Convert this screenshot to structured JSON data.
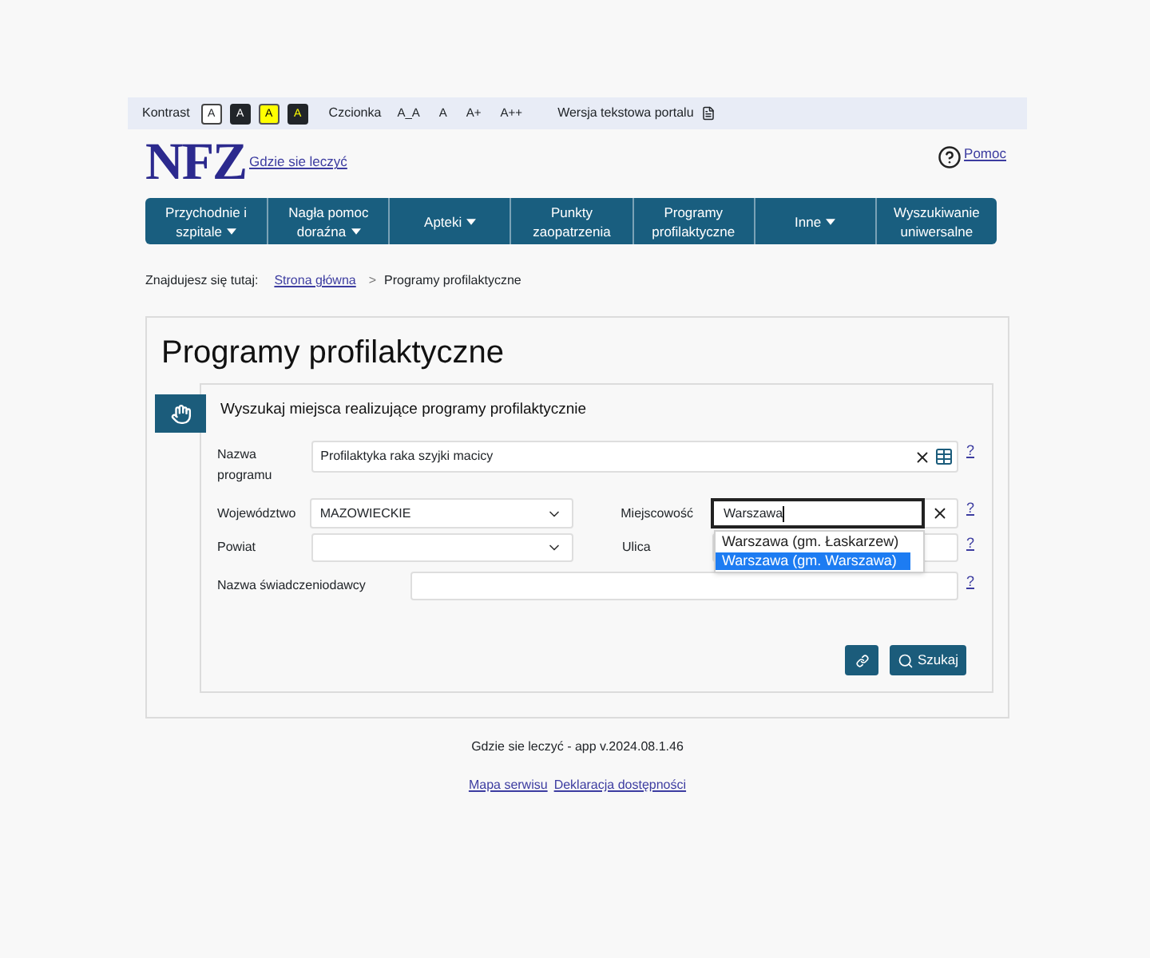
{
  "accessibility_bar": {
    "contrast_label": "Kontrast",
    "contrast_options": [
      {
        "label": "A",
        "kind": "standard"
      },
      {
        "label": "A",
        "kind": "inverse"
      },
      {
        "label": "A",
        "kind": "yellow"
      },
      {
        "label": "A",
        "kind": "blackyellow"
      }
    ],
    "font_label": "Czcionka",
    "font_options": [
      "A_A",
      "A",
      "A+",
      "A++"
    ],
    "text_version": "Wersja tekstowa portalu"
  },
  "header": {
    "logo": "NFZ",
    "site_link": "Gdzie sie leczyć",
    "help_link": "Pomoc"
  },
  "nav": [
    {
      "label": "Przychodnie i szpitale",
      "dropdown": true
    },
    {
      "label": "Nagła pomoc doraźna",
      "dropdown": true
    },
    {
      "label": "Apteki",
      "dropdown": true
    },
    {
      "label": "Punkty zaopatrzenia",
      "dropdown": false
    },
    {
      "label": "Programy profilaktyczne",
      "dropdown": false
    },
    {
      "label": "Inne",
      "dropdown": true
    },
    {
      "label": "Wyszukiwanie uniwersalne",
      "dropdown": false
    }
  ],
  "breadcrumb": {
    "label": "Znajdujesz się tutaj:",
    "separator": ">",
    "items": [
      {
        "label": "Strona główna",
        "kind": "link"
      },
      {
        "label": "Programy profilaktyczne",
        "kind": "current"
      }
    ]
  },
  "page_title": "Programy profilaktyczne",
  "search_panel": {
    "heading": "Wyszukaj miejsca realizujące programy profilaktycznie",
    "program": {
      "label": "Nazwa programu",
      "value": "Profilaktyka raka szyjki macicy",
      "help": "?"
    },
    "voivodeship": {
      "label": "Województwo",
      "value": "MAZOWIECKIE"
    },
    "county": {
      "label": "Powiat"
    },
    "locality": {
      "label": "Miejscowość",
      "value": "Warszawa",
      "focused": true,
      "help": "?",
      "suggestions": [
        {
          "label": "Warszawa (gm. Łaskarzew)",
          "selected": false
        },
        {
          "label": "Warszawa (gm. Warszawa)",
          "selected": true
        }
      ]
    },
    "street": {
      "label": "Ulica",
      "help": "?"
    },
    "provider": {
      "label": "Nazwa świadczeniodawcy",
      "help": "?"
    },
    "buttons": [
      {
        "kind": "link"
      },
      {
        "kind": "search",
        "label": "Szukaj"
      }
    ]
  },
  "footer": {
    "version": "Gdzie sie leczyć - app v.2024.08.1.46",
    "links": [
      "Mapa serwisu",
      "Deklaracja dostępności"
    ]
  }
}
